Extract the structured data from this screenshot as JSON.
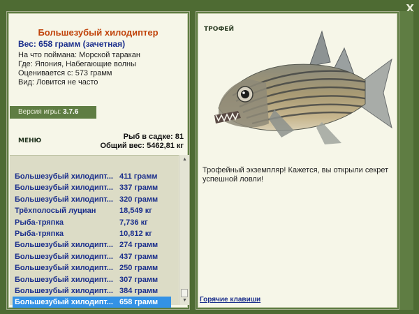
{
  "window": {
    "close_label": "X"
  },
  "fish": {
    "title": "Большезубый хилодиптер",
    "weight": "Вес: 658 грамм (зачетная)",
    "info": [
      "На что поймана: Морской таракан",
      "Где: Япония, Набегающие волны",
      "Оценивается с: 573 грамм",
      "Вид: Ловится не часто"
    ]
  },
  "version": {
    "label": "Версия игры:",
    "value": "3.7.6"
  },
  "menu_label": "МЕНЮ",
  "stats": {
    "keepnet": "Рыб в садке: 81",
    "total_weight": "Общий вес: 5462,81 кг"
  },
  "catch_list": [
    {
      "name": "Большезубый хилодипт...",
      "weight": "411 грамм"
    },
    {
      "name": "Большезубый хилодипт...",
      "weight": "337 грамм"
    },
    {
      "name": "Большезубый хилодипт...",
      "weight": "320 грамм"
    },
    {
      "name": "Трёхполосый луциан",
      "weight": "18,549 кг"
    },
    {
      "name": "Рыба-тряпка",
      "weight": "7,736 кг"
    },
    {
      "name": "Рыба-тряпка",
      "weight": "10,812 кг"
    },
    {
      "name": "Большезубый хилодипт...",
      "weight": "274 грамм"
    },
    {
      "name": "Большезубый хилодипт...",
      "weight": "437 грамм"
    },
    {
      "name": "Большезубый хилодипт...",
      "weight": "250 грамм"
    },
    {
      "name": "Большезубый хилодипт...",
      "weight": "307 грамм"
    },
    {
      "name": "Большезубый хилодипт...",
      "weight": "384 грамм"
    },
    {
      "name": "Большезубый хилодипт...",
      "weight": "658 грамм"
    }
  ],
  "selected_index": 11,
  "trophy": {
    "label": "ТРОФЕЙ",
    "text": "Трофейный экземпляр! Кажется, вы открыли секрет успешной ловли!"
  },
  "hotkeys_label": "Горячие клавиши",
  "colors": {
    "frame_green": "#4e6b33",
    "panel_bg": "#f6f6e8",
    "title_orange": "#c1440c",
    "text_blue": "#1b2f8c",
    "selection_blue": "#3392e6"
  }
}
